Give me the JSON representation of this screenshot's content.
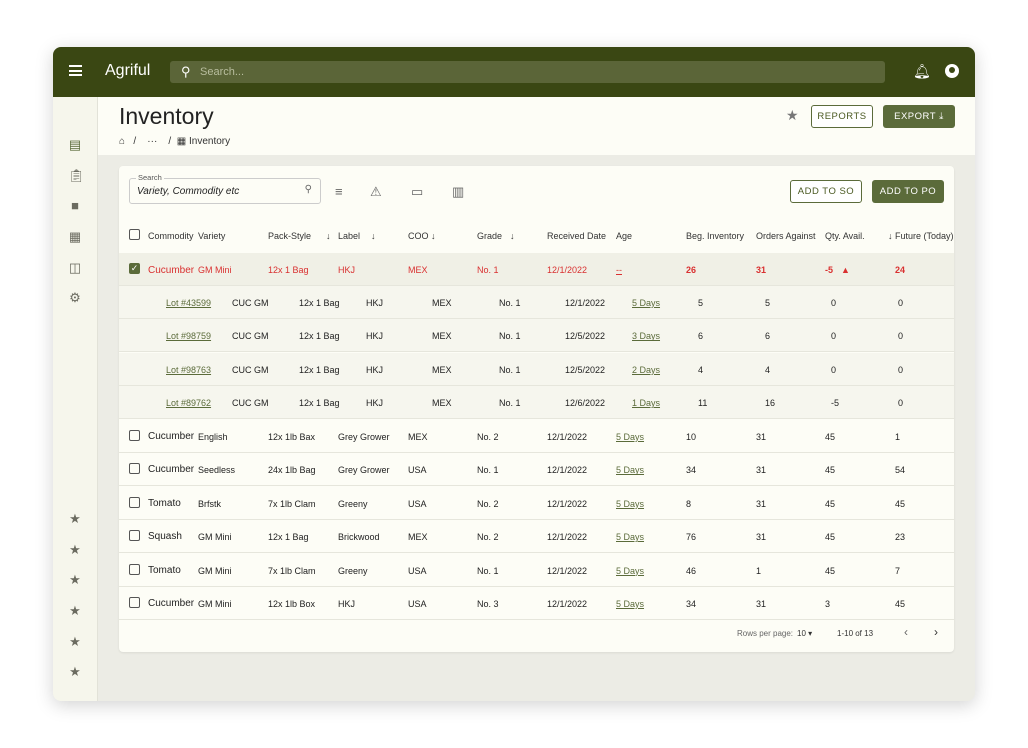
{
  "app": {
    "logo": "Agriful",
    "search_placeholder": "Search..."
  },
  "page": {
    "title": "Inventory",
    "breadcrumb": [
      "/",
      "···",
      "/",
      "Inventory"
    ],
    "reports": "REPORTS",
    "export": "EXPORT"
  },
  "toolbar": {
    "search_label": "Search",
    "search_placeholder": "Variety, Commodity etc",
    "add_so": "ADD TO SO",
    "add_po": "ADD TO PO"
  },
  "columns": [
    "Commodity",
    "Variety",
    "Pack-Style",
    "Label",
    "COO",
    "Grade",
    "Received Date",
    "Age",
    "Beg. Inventory",
    "Orders Against",
    "Qty. Avail.",
    "Future (Today)"
  ],
  "sortable": [
    false,
    false,
    true,
    true,
    true,
    true,
    false,
    false,
    false,
    false,
    true,
    false
  ],
  "selected_row": {
    "checked": true,
    "cells": [
      "Cucumber",
      "GM Mini",
      "12x 1 Bag",
      "HKJ",
      "MEX",
      "No. 1",
      "12/1/2022",
      "--",
      "26",
      "31",
      "-5",
      "24"
    ],
    "warning": true
  },
  "lots": [
    [
      "Lot #43599",
      "CUC GM",
      "12x 1 Bag",
      "HKJ",
      "MEX",
      "No. 1",
      "12/1/2022",
      "5 Days",
      "5",
      "5",
      "0",
      "0"
    ],
    [
      "Lot #98759",
      "CUC GM",
      "12x 1 Bag",
      "HKJ",
      "MEX",
      "No. 1",
      "12/5/2022",
      "3 Days",
      "6",
      "6",
      "0",
      "0"
    ],
    [
      "Lot #98763",
      "CUC GM",
      "12x 1 Bag",
      "HKJ",
      "MEX",
      "No. 1",
      "12/5/2022",
      "2 Days",
      "4",
      "4",
      "0",
      "0"
    ],
    [
      "Lot #89762",
      "CUC GM",
      "12x 1 Bag",
      "HKJ",
      "MEX",
      "No. 1",
      "12/6/2022",
      "1 Days",
      "11",
      "16",
      "-5",
      "0"
    ]
  ],
  "rows": [
    [
      "Cucumber",
      "English",
      "12x 1lb Bax",
      "Grey Grower",
      "MEX",
      "No. 2",
      "12/1/2022",
      "5 Days",
      "10",
      "31",
      "45",
      "1"
    ],
    [
      "Cucumber",
      "Seedless",
      "24x 1lb Bag",
      "Grey Grower",
      "USA",
      "No. 1",
      "12/1/2022",
      "5 Days",
      "34",
      "31",
      "45",
      "54"
    ],
    [
      "Tomato",
      "Brfstk",
      "7x 1lb Clam",
      "Greeny",
      "USA",
      "No. 2",
      "12/1/2022",
      "5 Days",
      "8",
      "31",
      "45",
      "45"
    ],
    [
      "Squash",
      "GM Mini",
      "12x 1 Bag",
      "Brickwood",
      "MEX",
      "No. 2",
      "12/1/2022",
      "5 Days",
      "76",
      "31",
      "45",
      "23"
    ],
    [
      "Tomato",
      "GM Mini",
      "7x 1lb Clam",
      "Greeny",
      "USA",
      "No. 1",
      "12/1/2022",
      "5 Days",
      "46",
      "1",
      "45",
      "7"
    ],
    [
      "Cucumber",
      "GM Mini",
      "12x 1lb Box",
      "HKJ",
      "USA",
      "No. 3",
      "12/1/2022",
      "5 Days",
      "34",
      "31",
      "3",
      "45"
    ]
  ],
  "pagination": {
    "rows_per_page_label": "Rows per page:",
    "rows_per_page": "10",
    "range": "1-10 of 13"
  },
  "colors": {
    "brand": "#3a4713",
    "accent": "#5b6b3a",
    "alert": "#d93030"
  }
}
